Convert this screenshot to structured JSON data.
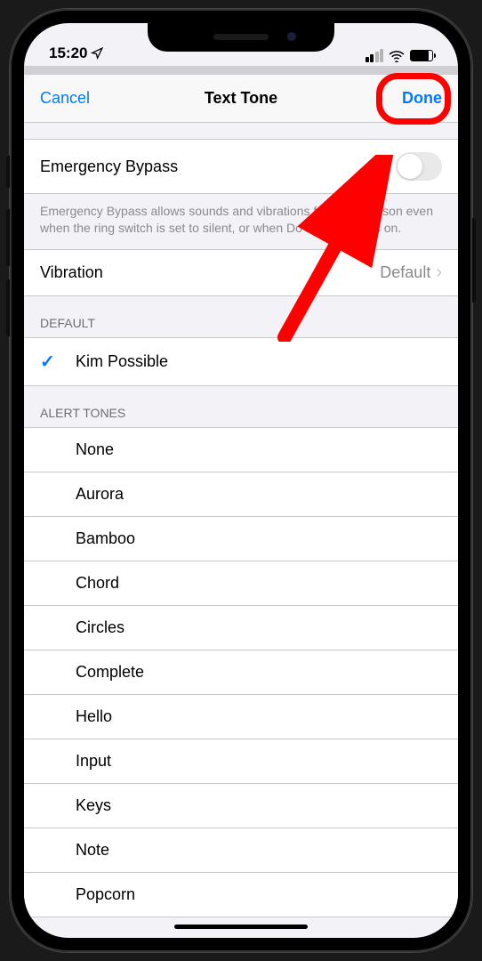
{
  "statusbar": {
    "time": "15:20"
  },
  "header": {
    "cancel": "Cancel",
    "title": "Text Tone",
    "done": "Done"
  },
  "emergency": {
    "label": "Emergency Bypass",
    "enabled": false,
    "footer": "Emergency Bypass allows sounds and vibrations from this person even when the ring switch is set to silent, or when Do Not Disturb is on."
  },
  "vibration": {
    "label": "Vibration",
    "value": "Default"
  },
  "default_section": {
    "header": "DEFAULT",
    "tone": "Kim Possible"
  },
  "alert_tones": {
    "header": "ALERT TONES",
    "items": [
      "None",
      "Aurora",
      "Bamboo",
      "Chord",
      "Circles",
      "Complete",
      "Hello",
      "Input",
      "Keys",
      "Note",
      "Popcorn"
    ]
  }
}
